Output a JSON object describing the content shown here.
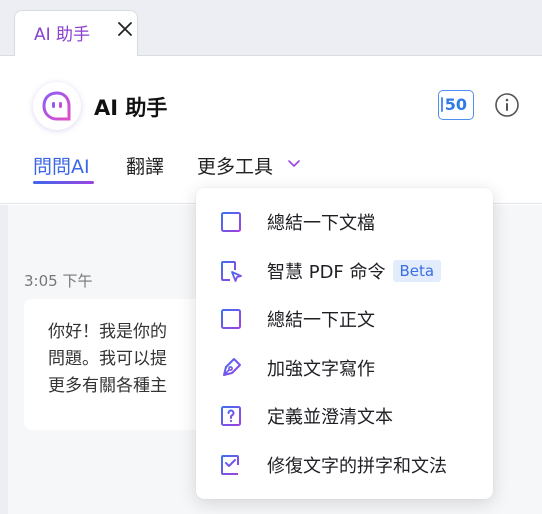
{
  "tab": {
    "title": "AI 助手"
  },
  "header": {
    "title": "AI 助手",
    "credits": "50"
  },
  "nav": {
    "tabs": [
      {
        "label": "問問AI",
        "active": true
      },
      {
        "label": "翻譯",
        "active": false
      },
      {
        "label": "更多工具",
        "active": false
      }
    ]
  },
  "chat": {
    "timestamp": "3:05 下午",
    "lines": [
      "你好！我是你的",
      "問題。我可以提",
      "更多有關各種主"
    ]
  },
  "menu": {
    "items": [
      {
        "label": "總結一下文檔",
        "icon": "document-summary-icon"
      },
      {
        "label": "智慧 PDF 命令",
        "icon": "smart-command-icon",
        "badge": "Beta"
      },
      {
        "label": "總結一下正文",
        "icon": "text-summary-icon"
      },
      {
        "label": "加強文字寫作",
        "icon": "pen-nib-icon"
      },
      {
        "label": "定義並澄清文本",
        "icon": "question-document-icon"
      },
      {
        "label": "修復文字的拼字和文法",
        "icon": "grammar-check-icon"
      }
    ]
  },
  "colors": {
    "accent": "#3b66e8",
    "brand_purple": "#8a3fd1",
    "credits_blue": "#2f7ae6",
    "beta_bg": "#e3ecfd"
  }
}
